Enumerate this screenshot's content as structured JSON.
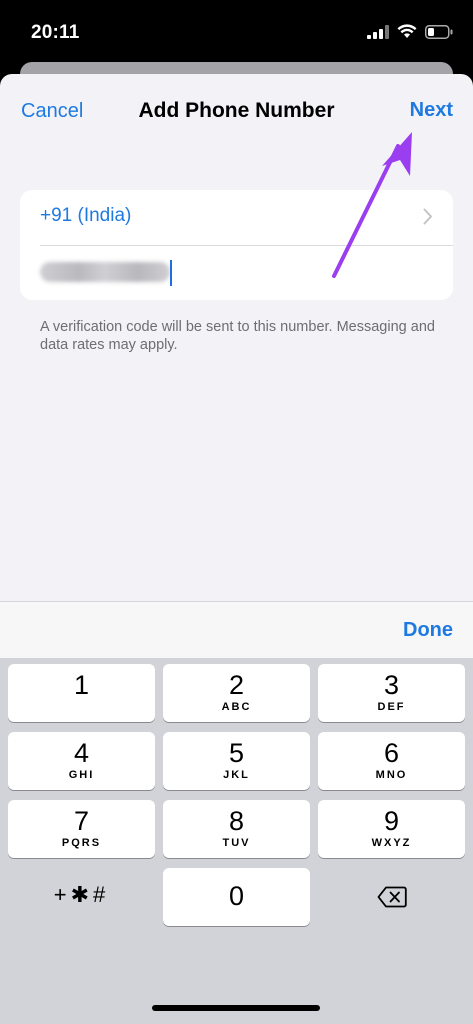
{
  "status_bar": {
    "time": "20:11"
  },
  "nav": {
    "cancel_label": "Cancel",
    "title": "Add Phone Number",
    "next_label": "Next"
  },
  "form": {
    "country": "+91 (India)",
    "footnote": "A verification code will be sent to this number. Messaging and data rates may apply."
  },
  "keyboard": {
    "done_label": "Done",
    "keys": [
      {
        "digit": "1",
        "letters": ""
      },
      {
        "digit": "2",
        "letters": "ABC"
      },
      {
        "digit": "3",
        "letters": "DEF"
      },
      {
        "digit": "4",
        "letters": "GHI"
      },
      {
        "digit": "5",
        "letters": "JKL"
      },
      {
        "digit": "6",
        "letters": "MNO"
      },
      {
        "digit": "7",
        "letters": "PQRS"
      },
      {
        "digit": "8",
        "letters": "TUV"
      },
      {
        "digit": "9",
        "letters": "WXYZ"
      }
    ],
    "symbols_label": "+✱#",
    "zero": "0"
  },
  "colors": {
    "accent": "#1e7ae0",
    "annotation_arrow": "#9b3ef0"
  }
}
